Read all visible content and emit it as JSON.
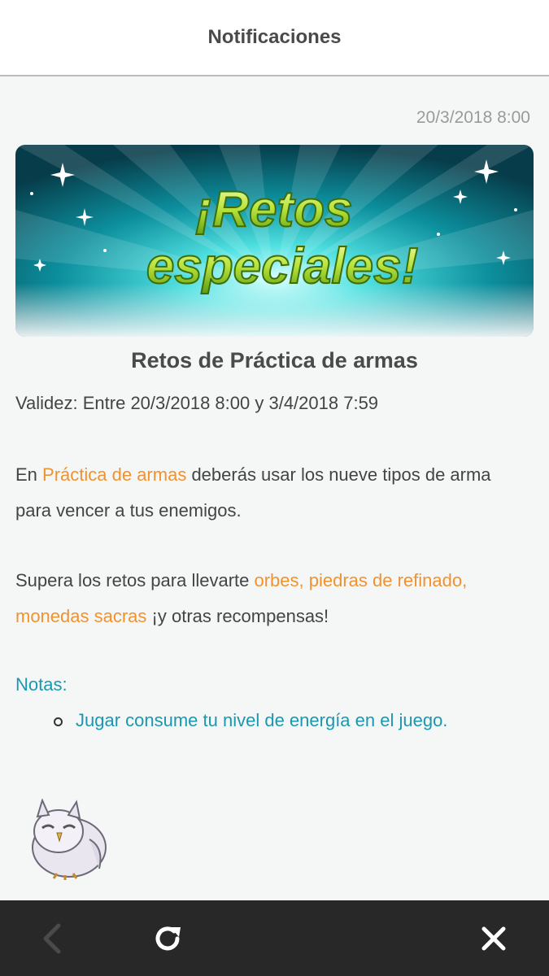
{
  "header": {
    "title": "Notificaciones"
  },
  "post": {
    "timestamp": "20/3/2018 8:00",
    "banner_line1": "¡Retos",
    "banner_line2": "especiales!",
    "title": "Retos de Práctica de armas",
    "validity": "Validez: Entre 20/3/2018 8:00 y 3/4/2018 7:59",
    "p1_pre": "En ",
    "p1_hl": "Práctica de armas",
    "p1_post": " deberás usar los nueve tipos de arma para vencer a tus enemigos.",
    "p2_pre": "Supera los retos para llevarte ",
    "p2_hl": "orbes, piedras de refinado, monedas sacras",
    "p2_post": " ¡y otras recompensas!",
    "notes_title": "Notas:",
    "notes_item": "Jugar consume tu nivel de energía en el juego."
  },
  "bottom_bar": {
    "back_icon": "chevron-left-icon",
    "refresh_icon": "refresh-icon",
    "close_icon": "close-icon"
  },
  "colors": {
    "accent_orange": "#f0922f",
    "accent_teal": "#1a98b0",
    "bar_dark": "#282828"
  }
}
